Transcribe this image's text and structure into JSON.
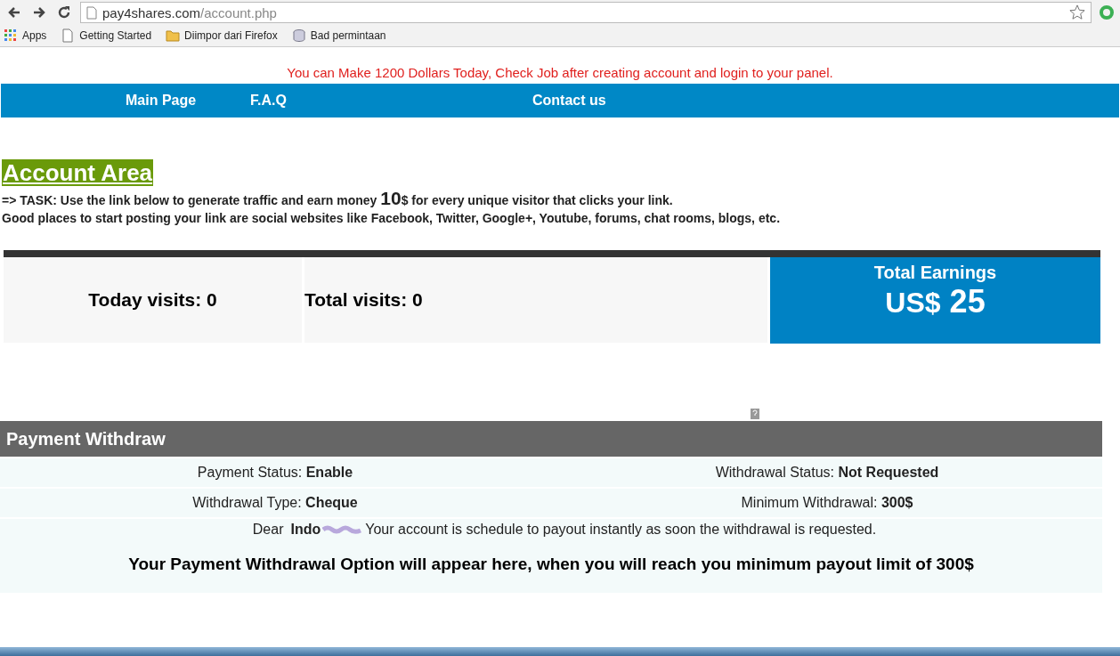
{
  "browser": {
    "url_host": "pay4shares.com",
    "url_path": "/account.php",
    "bookmarks": [
      {
        "label": "Apps",
        "kind": "apps"
      },
      {
        "label": "Getting Started",
        "kind": "page"
      },
      {
        "label": "Diimpor dari Firefox",
        "kind": "folder"
      },
      {
        "label": "Bad permintaan",
        "kind": "db"
      }
    ]
  },
  "notice": "You can Make 1200 Dollars Today, Check Job after creating account and login to your panel.",
  "nav": [
    "Main Page",
    "F.A.Q",
    "Contact us"
  ],
  "heading": "Account Area",
  "task": {
    "before": "=> TASK: Use the link below to generate traffic and earn money ",
    "amount": "10",
    "after": "$ for every unique visitor that clicks your link."
  },
  "tip": "Good places to start posting your link are social websites like Facebook, Twitter, Google+, Youtube, forums, chat rooms, blogs, etc.",
  "stats": [
    {
      "label": "Today visits:",
      "value": "0"
    },
    {
      "label": "Total visits:",
      "value": "0"
    }
  ],
  "earnings": {
    "title": "Total Earnings",
    "currency": "US$",
    "amount": "25"
  },
  "withdraw": {
    "title": "Payment Withdraw",
    "rows": [
      [
        {
          "label": "Payment Status: ",
          "value": "Enable"
        },
        {
          "label": "Withdrawal Status:",
          "value": "Not Requested"
        }
      ],
      [
        {
          "label": "Withdrawal Type:",
          "value": "Cheque"
        },
        {
          "label": "Minimum Withdrawal:",
          "value": "300$"
        }
      ]
    ],
    "dear": {
      "greeting": "Dear",
      "name": "Indo",
      "message": "Your account is schedule to payout instantly as soon the withdrawal is requested."
    },
    "notice": "Your Payment Withdrawal Option will appear here, when you will reach you minimum payout limit of 300$"
  }
}
